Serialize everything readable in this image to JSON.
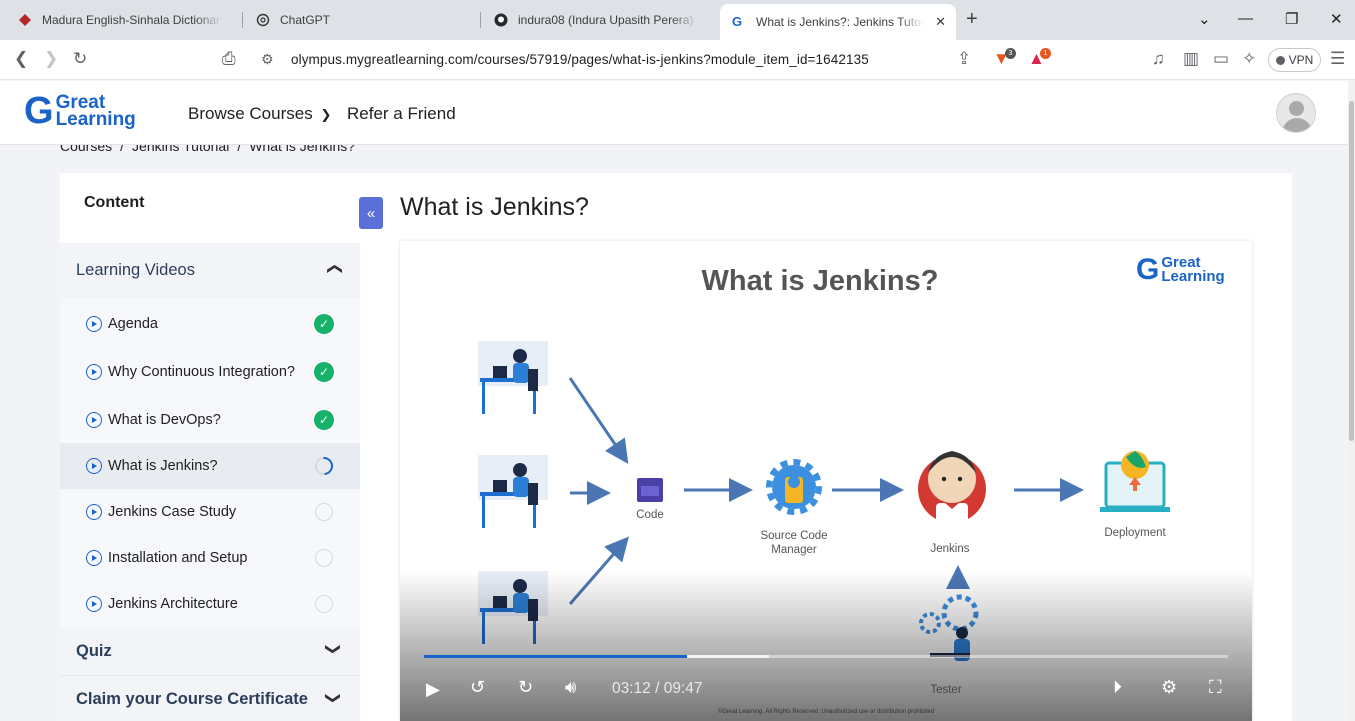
{
  "browser": {
    "tabs": [
      {
        "title": "Madura English-Sinhala Dictionary -",
        "icon": "dictionary-icon"
      },
      {
        "title": "ChatGPT",
        "icon": "chatgpt-icon"
      },
      {
        "title": "indura08 (Indura Upasith Perera)",
        "icon": "github-icon"
      },
      {
        "title": "What is Jenkins?: Jenkins Tutorial",
        "icon": "great-learning-icon",
        "active": true
      }
    ],
    "url": "olympus.mygreatlearning.com/courses/57919/pages/what-is-jenkins?module_item_id=1642135",
    "vpn_label": "VPN",
    "brave_badge": "3",
    "alert_badge": "1"
  },
  "site": {
    "logo_top": "Great",
    "logo_bottom": "Learning",
    "nav": [
      "Browse Courses",
      "Refer a Friend"
    ]
  },
  "breadcrumb": [
    "Courses",
    "/",
    "Jenkins Tutorial",
    "/",
    "What is Jenkins?"
  ],
  "sidebar": {
    "title": "Content",
    "sections": [
      {
        "label": "Learning Videos",
        "expanded": true
      },
      {
        "label": "Quiz",
        "expanded": false
      },
      {
        "label": "Claim your Course Certificate",
        "expanded": false
      }
    ],
    "lessons": [
      {
        "label": "Agenda",
        "status": "done"
      },
      {
        "label": "Why Continuous Integration?",
        "status": "done"
      },
      {
        "label": "What is DevOps?",
        "status": "done"
      },
      {
        "label": "What is Jenkins?",
        "status": "in-progress"
      },
      {
        "label": "Jenkins Case Study",
        "status": "todo"
      },
      {
        "label": "Installation and Setup",
        "status": "todo"
      },
      {
        "label": "Jenkins Architecture",
        "status": "todo"
      }
    ]
  },
  "main": {
    "title": "What is Jenkins?",
    "video": {
      "slide_title": "What is Jenkins?",
      "slide_logo_top": "Great",
      "slide_logo_bottom": "Learning",
      "labels": {
        "code": "Code",
        "scm_line1": "Source Code",
        "scm_line2": "Manager",
        "jenkins": "Jenkins",
        "deployment": "Deployment",
        "tester": "Tester"
      },
      "copyright": "©Great Learning. All Rights Reserved. Unauthorized use or distribution prohibited",
      "current_time": "03:12",
      "duration": "09:47",
      "time_display": "03:12 / 09:47",
      "played_fraction": 0.327,
      "buffered_fraction": 0.429
    }
  },
  "colors": {
    "brand_blue": "#1a63c9",
    "complete_green": "#17b26a",
    "collapse_button": "#5a6fd8"
  }
}
